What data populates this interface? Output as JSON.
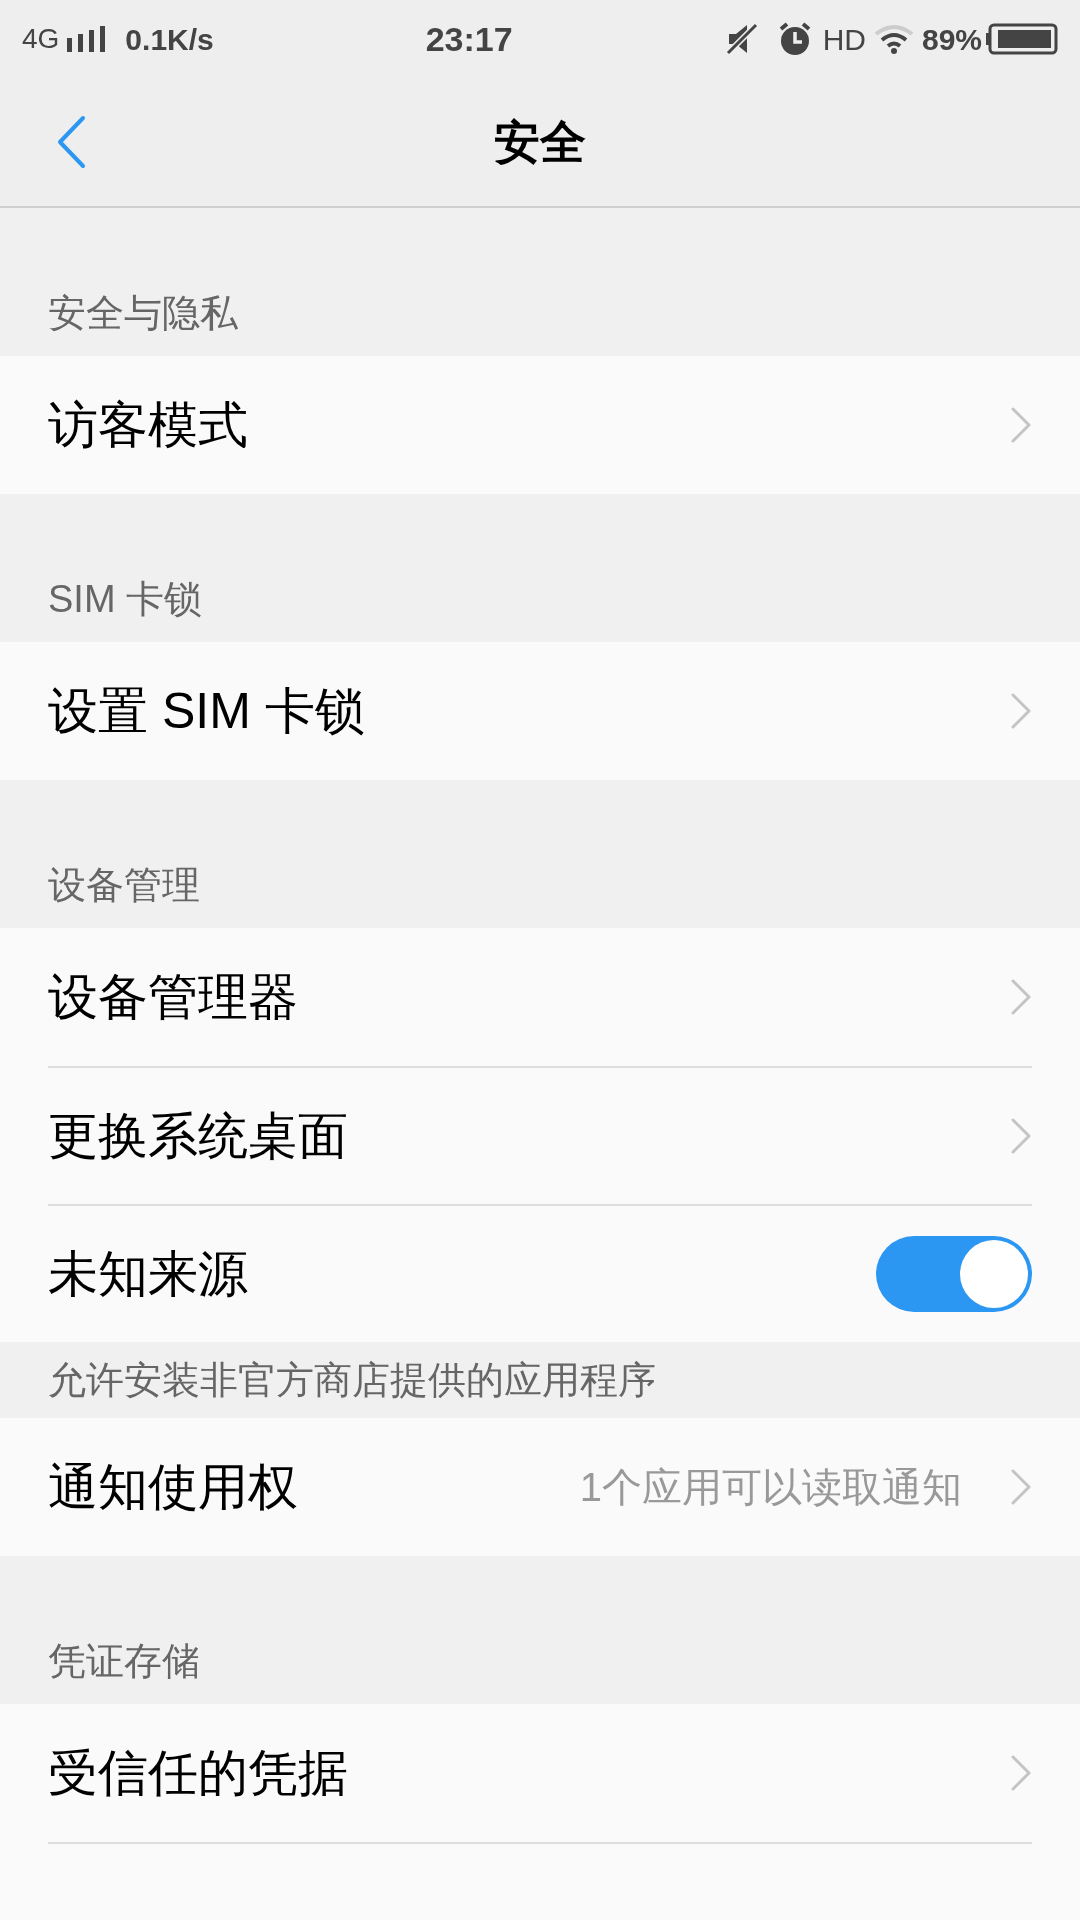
{
  "status_bar": {
    "network": "4G",
    "speed": "0.1K/s",
    "time": "23:17",
    "hd": "HD",
    "battery": "89%"
  },
  "header": {
    "title": "安全"
  },
  "sections": [
    {
      "header": "安全与隐私",
      "rows": [
        {
          "kind": "link",
          "label": "访客模式"
        }
      ]
    },
    {
      "header": "SIM 卡锁",
      "rows": [
        {
          "kind": "link",
          "label": "设置 SIM 卡锁"
        }
      ]
    },
    {
      "header": "设备管理",
      "rows": [
        {
          "kind": "link",
          "label": "设备管理器"
        },
        {
          "kind": "link",
          "label": "更换系统桌面"
        },
        {
          "kind": "toggle",
          "label": "未知来源",
          "on": true,
          "note": "允许安装非官方商店提供的应用程序"
        },
        {
          "kind": "link",
          "label": "通知使用权",
          "value": "1个应用可以读取通知"
        }
      ]
    },
    {
      "header": "凭证存储",
      "rows": [
        {
          "kind": "link",
          "label": "受信任的凭据"
        },
        {
          "kind": "partial"
        }
      ]
    }
  ]
}
